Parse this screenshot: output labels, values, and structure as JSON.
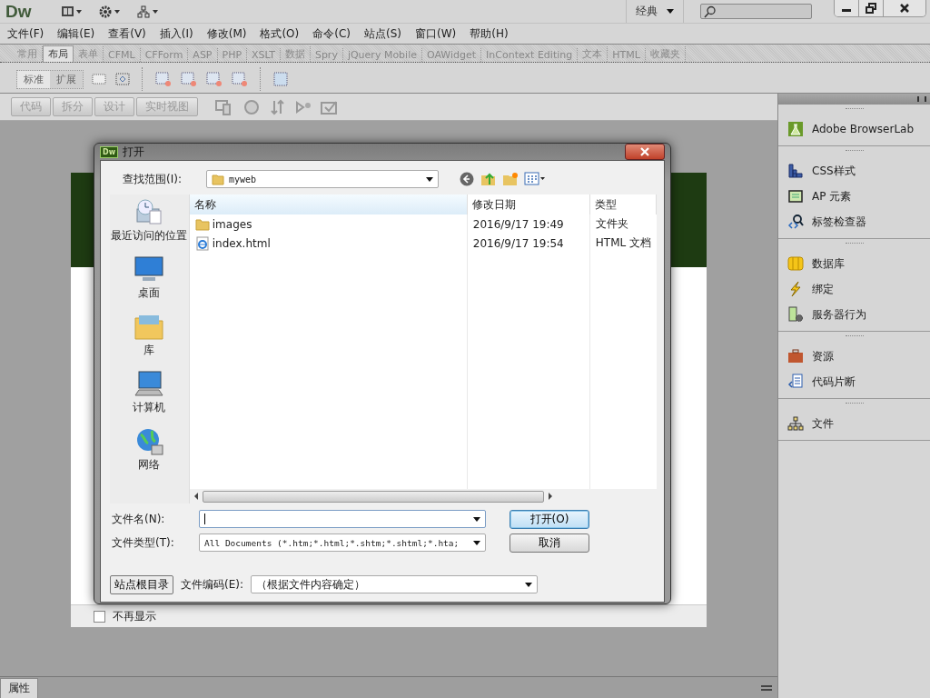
{
  "app": {
    "logo": "Dw",
    "workspace": "经典"
  },
  "menu": [
    "文件(F)",
    "编辑(E)",
    "查看(V)",
    "插入(I)",
    "修改(M)",
    "格式(O)",
    "命令(C)",
    "站点(S)",
    "窗口(W)",
    "帮助(H)"
  ],
  "insert_panel": {
    "tabs": [
      {
        "label": "常用",
        "selected": false
      },
      {
        "label": "布局",
        "selected": true
      },
      {
        "label": "表单",
        "selected": false
      },
      {
        "label": "CFML",
        "selected": false
      },
      {
        "label": "CFForm",
        "selected": false
      },
      {
        "label": "ASP",
        "selected": false
      },
      {
        "label": "PHP",
        "selected": false
      },
      {
        "label": "XSLT",
        "selected": false
      },
      {
        "label": "数据",
        "selected": false
      },
      {
        "label": "Spry",
        "selected": false
      },
      {
        "label": "jQuery Mobile",
        "selected": false
      },
      {
        "label": "OAWidget",
        "selected": false
      },
      {
        "label": "InContext Editing",
        "selected": false
      },
      {
        "label": "文本",
        "selected": false
      },
      {
        "label": "HTML",
        "selected": false
      },
      {
        "label": "收藏夹",
        "selected": false
      }
    ],
    "modes": [
      "标准",
      "扩展"
    ]
  },
  "document_toolbar": {
    "views": [
      "代码",
      "拆分",
      "设计",
      "实时视图"
    ]
  },
  "welcome_page": {
    "checkbox": {
      "label": "不再显示",
      "checked": false
    }
  },
  "dialog": {
    "app_icon": "Dw",
    "title": "打开",
    "look_in": {
      "label": "查找范围(I):",
      "value": "myweb"
    },
    "places": [
      {
        "label": "最近访问的位置",
        "kind": "recent"
      },
      {
        "label": "桌面",
        "kind": "desktop"
      },
      {
        "label": "库",
        "kind": "library"
      },
      {
        "label": "计算机",
        "kind": "computer"
      },
      {
        "label": "网络",
        "kind": "network"
      }
    ],
    "columns": [
      "名称",
      "修改日期",
      "类型"
    ],
    "files": [
      {
        "name": "images",
        "modified": "2016/9/17 19:49",
        "type": "文件夹",
        "kind": "folder"
      },
      {
        "name": "index.html",
        "modified": "2016/9/17 19:54",
        "type": "HTML 文档",
        "kind": "html"
      }
    ],
    "file_name": {
      "label": "文件名(N):"
    },
    "file_type": {
      "label": "文件类型(T):",
      "value": "All Documents (*.htm;*.html;*.shtm;*.shtml;*.hta;"
    },
    "encoding": {
      "label": "文件编码(E):",
      "value": "（根据文件内容确定）"
    },
    "site_root_button": "站点根目录",
    "open_button": "打开(O)",
    "cancel_button": "取消"
  },
  "right_panel": {
    "groups": [
      {
        "items": [
          {
            "label": "Adobe BrowserLab",
            "kind": "browserlab"
          }
        ]
      },
      {
        "items": [
          {
            "label": "CSS样式",
            "kind": "css"
          },
          {
            "label": "AP 元素",
            "kind": "ap"
          },
          {
            "label": "标签检查器",
            "kind": "tag"
          }
        ]
      },
      {
        "items": [
          {
            "label": "数据库",
            "kind": "database"
          },
          {
            "label": "绑定",
            "kind": "bindings"
          },
          {
            "label": "服务器行为",
            "kind": "server"
          }
        ]
      },
      {
        "items": [
          {
            "label": "资源",
            "kind": "assets"
          },
          {
            "label": "代码片断",
            "kind": "snippets"
          }
        ]
      },
      {
        "items": [
          {
            "label": "文件",
            "kind": "files"
          }
        ]
      }
    ]
  },
  "properties_bar": {
    "tab": "属性"
  }
}
